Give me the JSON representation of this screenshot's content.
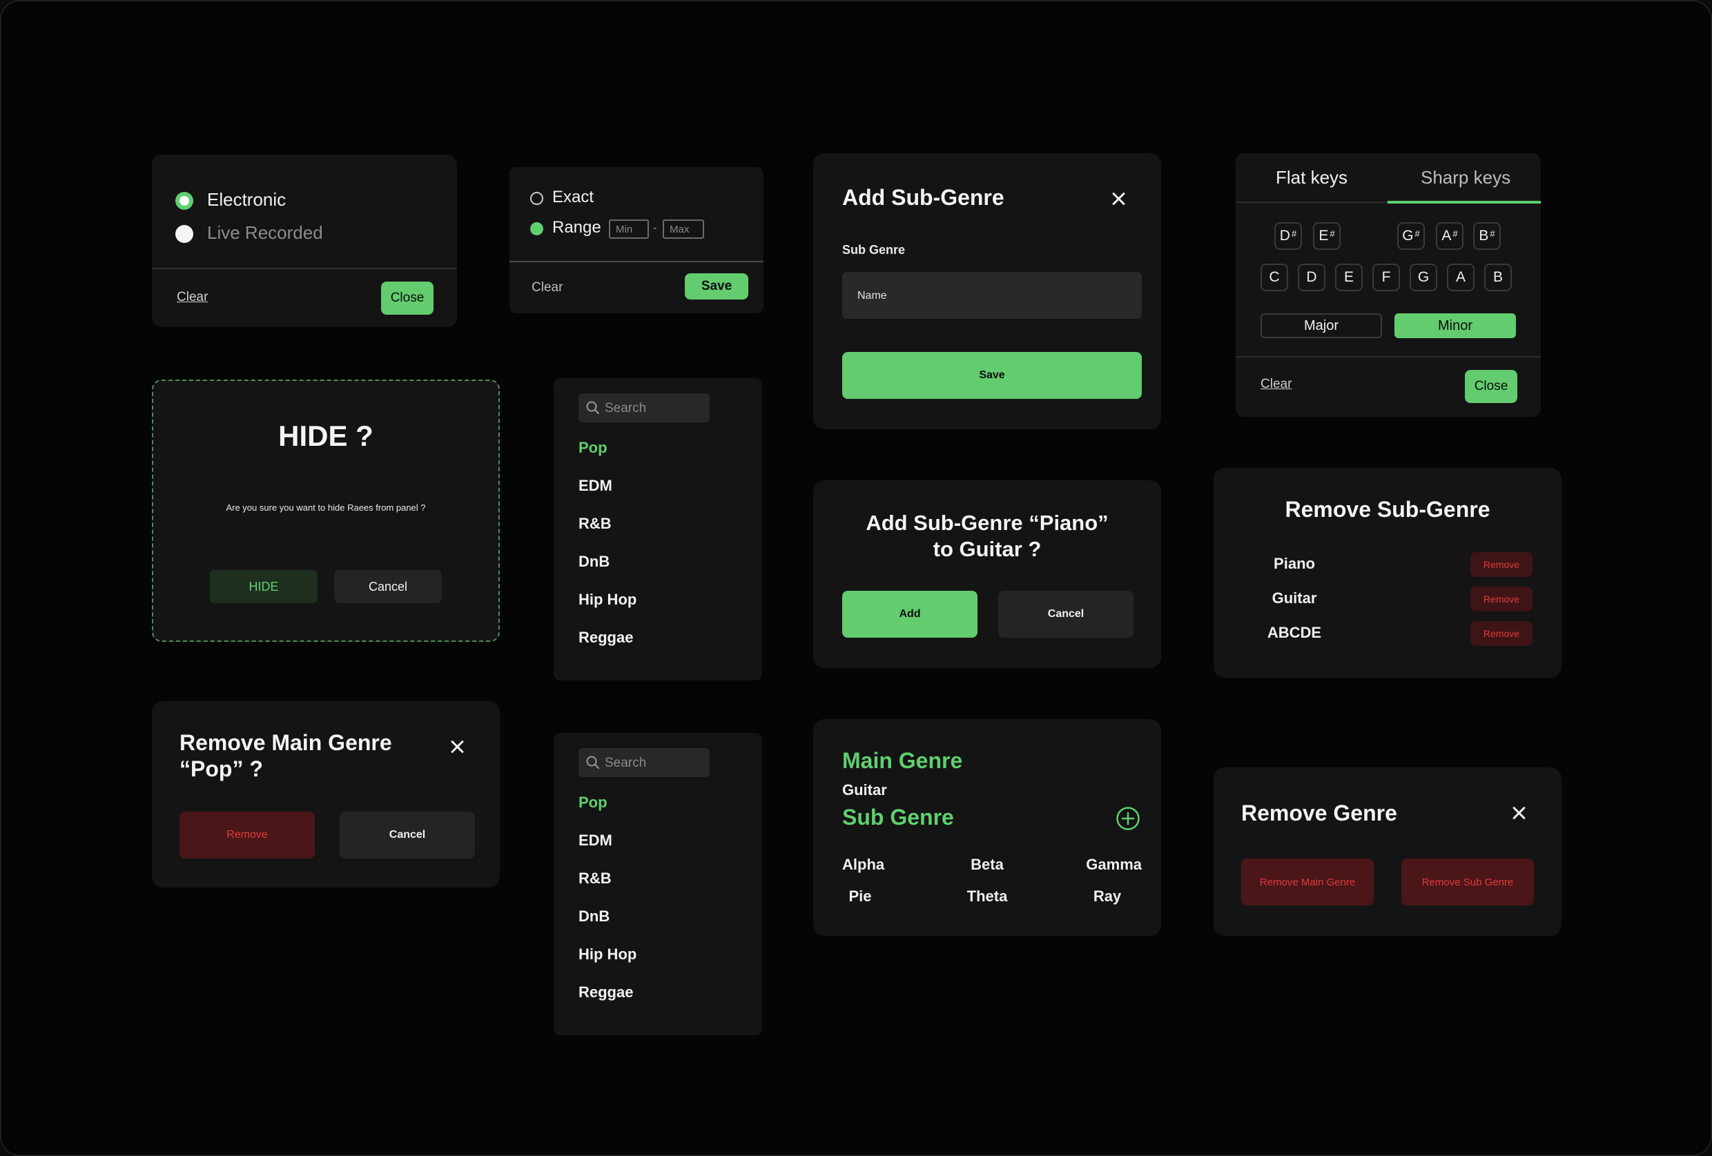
{
  "type_filter": {
    "options": [
      "Electronic",
      "Live Recorded"
    ],
    "clear": "Clear",
    "close": "Close"
  },
  "bpm_filter": {
    "exact": "Exact",
    "range": "Range",
    "min_placeholder": "Min",
    "dash": "-",
    "max_placeholder": "Max",
    "clear": "Clear",
    "save": "Save"
  },
  "add_sub_genre_dialog": {
    "title": "Add Sub-Genre",
    "field_label": "Sub Genre",
    "name_placeholder": "Name",
    "save": "Save"
  },
  "key_filter": {
    "tabs": [
      "Flat keys",
      "Sharp keys"
    ],
    "sharp_keys": [
      {
        "note": "D",
        "acc": "#"
      },
      {
        "note": "E",
        "acc": "#"
      },
      {
        "note": "G",
        "acc": "#"
      },
      {
        "note": "A",
        "acc": "#"
      },
      {
        "note": "B",
        "acc": "#"
      }
    ],
    "natural_keys": [
      "C",
      "D",
      "E",
      "F",
      "G",
      "A",
      "B"
    ],
    "scale": [
      "Major",
      "Minor"
    ],
    "clear": "Clear",
    "close": "Close"
  },
  "hide_dialog": {
    "title": "HIDE ?",
    "message": "Are you sure you want to hide Raees from panel ?",
    "hide": "HIDE",
    "cancel": "Cancel"
  },
  "genre_list_1": {
    "search_placeholder": "Search",
    "items": [
      "Pop",
      "EDM",
      "R&B",
      "DnB",
      "Hip Hop",
      "Reggae"
    ]
  },
  "genre_list_2": {
    "search_placeholder": "Search",
    "items": [
      "Pop",
      "EDM",
      "R&B",
      "DnB",
      "Hip Hop",
      "Reggae"
    ]
  },
  "add_confirm_dialog": {
    "title_line1": "Add Sub-Genre “Piano”",
    "title_line2": "to Guitar ?",
    "add": "Add",
    "cancel": "Cancel"
  },
  "remove_sub_genre_dialog": {
    "title": "Remove Sub-Genre",
    "items": [
      "Piano",
      "Guitar",
      "ABCDE"
    ],
    "remove": "Remove"
  },
  "remove_main_genre_dialog": {
    "title_line1": "Remove Main Genre",
    "title_line2": "“Pop” ?",
    "remove": "Remove",
    "cancel": "Cancel"
  },
  "genre_info": {
    "main_label": "Main Genre",
    "main_value": "Guitar",
    "sub_label": "Sub Genre",
    "sub_genres": [
      "Alpha",
      "Beta",
      "Gamma",
      "Pie",
      "Theta",
      "Ray"
    ]
  },
  "remove_genre_dialog": {
    "title": "Remove Genre",
    "remove_main": "Remove Main Genre",
    "remove_sub": "Remove Sub Genre"
  },
  "colors": {
    "accent": "#62cc6e",
    "card": "#141415",
    "danger_bg": "#3e1416",
    "danger_text": "#e23a3a"
  }
}
